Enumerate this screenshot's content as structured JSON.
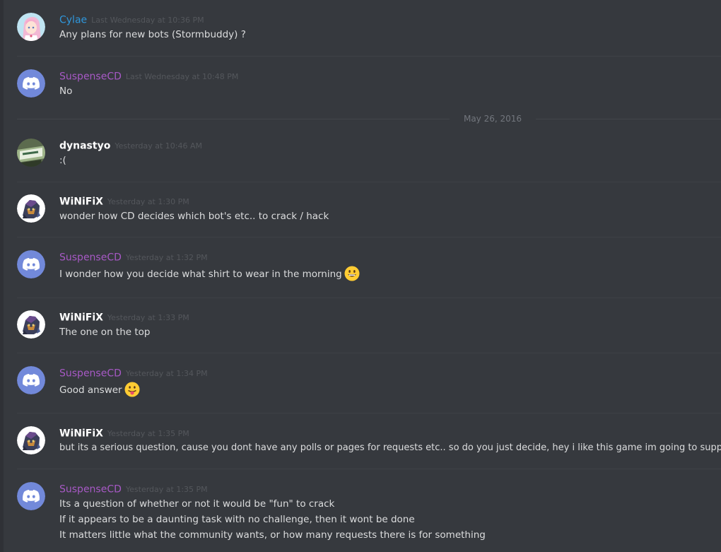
{
  "date_divider": "May 26, 2016",
  "messages": [
    {
      "author": "Cylae",
      "timestamp": "Last Wednesday at 10:36 PM",
      "lines": [
        "Any plans for new bots (Stormbuddy) ?"
      ],
      "avatar": "anime-avatar",
      "color": "#2f97dc"
    },
    {
      "author": "SuspenseCD",
      "timestamp": "Last Wednesday at 10:48 PM",
      "lines": [
        "No"
      ],
      "avatar": "discord-default-avatar",
      "color": "#a759c5"
    },
    {
      "author": "dynastyo",
      "timestamp": "Yesterday at 10:46 AM",
      "lines": [
        ":("
      ],
      "avatar": "photo-avatar",
      "color": "#ffffff"
    },
    {
      "author": "WiNiFiX",
      "timestamp": "Yesterday at 1:30 PM",
      "lines": [
        "wonder how CD decides which bot's etc.. to crack / hack"
      ],
      "avatar": "character-avatar",
      "color": "#ffffff"
    },
    {
      "author": "SuspenseCD",
      "timestamp": "Yesterday at 1:32 PM",
      "lines": [
        "I wonder how you decide what shirt to wear in the morning"
      ],
      "emoji": "smiley",
      "avatar": "discord-default-avatar",
      "color": "#a759c5"
    },
    {
      "author": "WiNiFiX",
      "timestamp": "Yesterday at 1:33 PM",
      "lines": [
        "The one on the top"
      ],
      "avatar": "character-avatar",
      "color": "#ffffff"
    },
    {
      "author": "SuspenseCD",
      "timestamp": "Yesterday at 1:34 PM",
      "lines": [
        "Good answer"
      ],
      "emoji": "tongue",
      "avatar": "discord-default-avatar",
      "color": "#a759c5"
    },
    {
      "author": "WiNiFiX",
      "timestamp": "Yesterday at 1:35 PM",
      "lines": [
        "but its a serious question, cause you dont have any polls or pages for requests etc.. so do you just decide, hey i like this game im going to support it"
      ],
      "avatar": "character-avatar",
      "color": "#ffffff"
    },
    {
      "author": "SuspenseCD",
      "timestamp": "Yesterday at 1:35 PM",
      "lines": [
        "Its a question of whether or not it would be \"fun\" to crack",
        "If it appears to be a daunting task with no challenge, then it wont be done",
        "It matters little what the community wants, or how many requests there is for something"
      ],
      "avatar": "discord-default-avatar",
      "color": "#a759c5"
    }
  ]
}
